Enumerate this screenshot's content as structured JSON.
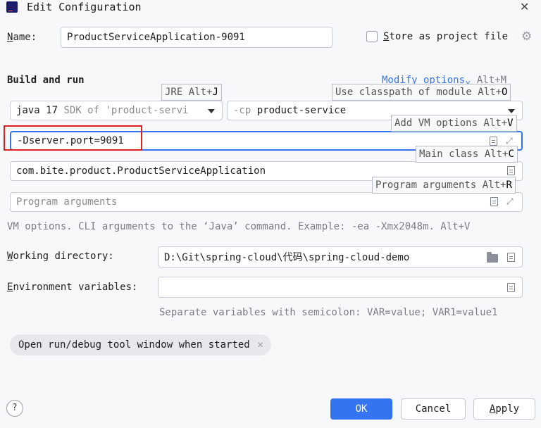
{
  "window": {
    "title": "Edit Configuration",
    "app_icon_letter": "IJ"
  },
  "name_row": {
    "label": "Name:",
    "value": "ProductServiceApplication-9091",
    "store_label": "Store as project file"
  },
  "build": {
    "heading": "Build and run",
    "modify_options": "Modify options",
    "modify_shortcut": "Alt+M",
    "jre_value": "java 17",
    "jre_sdk": "SDK of 'product-servi",
    "cp_prefix": "-cp",
    "cp_value": "product-service",
    "vm_options_value": "-Dserver.port=9091",
    "main_class_value": "com.bite.product.ProductServiceApplication",
    "program_args_placeholder": "Program arguments",
    "vm_help": "VM options. CLI arguments to the ‘Java’ command. Example: -ea -Xmx2048m. Alt+V"
  },
  "hints": {
    "jre": {
      "text": "JRE Alt+",
      "key": "J"
    },
    "classpath": {
      "text": "Use classpath of module Alt+",
      "key": "O"
    },
    "vm": {
      "text": "Add VM options Alt+",
      "key": "V"
    },
    "main": {
      "text": "Main class Alt+",
      "key": "C"
    },
    "args": {
      "text": "Program arguments Alt+",
      "key": "R"
    }
  },
  "working_dir": {
    "label": "Working directory:",
    "value": "D:\\Git\\spring-cloud\\代码\\spring-cloud-demo"
  },
  "env": {
    "label": "Environment variables:",
    "value": "",
    "help": "Separate variables with semicolon: VAR=value; VAR1=value1"
  },
  "chip": {
    "label": "Open run/debug tool window when started"
  },
  "footer": {
    "help": "?",
    "ok": "OK",
    "cancel": "Cancel",
    "apply": "Apply"
  },
  "colors": {
    "accent": "#3574f0",
    "highlight_border": "#e02020"
  }
}
